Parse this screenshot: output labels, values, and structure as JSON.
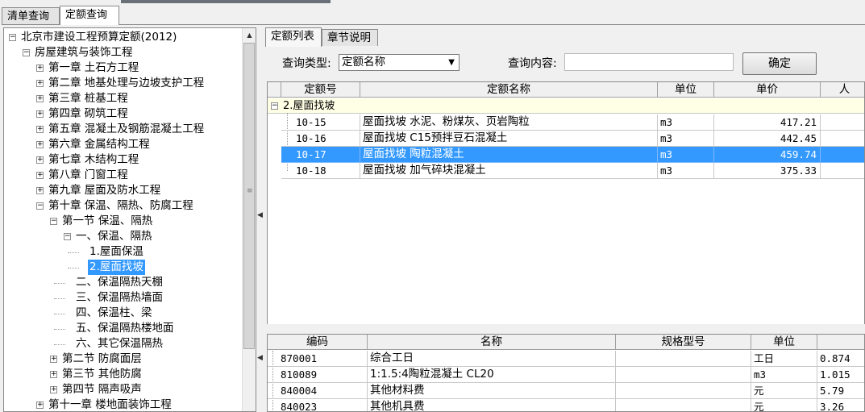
{
  "outer_tabs": [
    "清单查询",
    "定额查询"
  ],
  "tree": [
    {
      "level": 0,
      "expander": "⊟",
      "label": "北京市建设工程预算定额(2012)"
    },
    {
      "level": 1,
      "expander": "⊟",
      "label": "房屋建筑与装饰工程"
    },
    {
      "level": 2,
      "expander": "⊞",
      "label": "第一章 土石方工程"
    },
    {
      "level": 2,
      "expander": "⊞",
      "label": "第二章 地基处理与边坡支护工程"
    },
    {
      "level": 2,
      "expander": "⊞",
      "label": "第三章 桩基工程"
    },
    {
      "level": 2,
      "expander": "⊞",
      "label": "第四章 砌筑工程"
    },
    {
      "level": 2,
      "expander": "⊞",
      "label": "第五章 混凝土及钢筋混凝土工程"
    },
    {
      "level": 2,
      "expander": "⊞",
      "label": "第六章 金属结构工程"
    },
    {
      "level": 2,
      "expander": "⊞",
      "label": "第七章 木结构工程"
    },
    {
      "level": 2,
      "expander": "⊞",
      "label": "第八章 门窗工程"
    },
    {
      "level": 2,
      "expander": "⊞",
      "label": "第九章 屋面及防水工程"
    },
    {
      "level": 2,
      "expander": "⊟",
      "label": "第十章 保温、隔热、防腐工程"
    },
    {
      "level": 3,
      "expander": "⊟",
      "label": "第一节 保温、隔热"
    },
    {
      "level": 4,
      "expander": "⊟",
      "label": "一、保温、隔热"
    },
    {
      "level": 5,
      "expander": "",
      "label": "1.屋面保温"
    },
    {
      "level": 5,
      "expander": "",
      "label": "2.屋面找坡",
      "selected": true
    },
    {
      "level": 4,
      "expander": "",
      "label": "二、保温隔热天棚"
    },
    {
      "level": 4,
      "expander": "",
      "label": "三、保温隔热墙面"
    },
    {
      "level": 4,
      "expander": "",
      "label": "四、保温柱、梁"
    },
    {
      "level": 4,
      "expander": "",
      "label": "五、保温隔热楼地面"
    },
    {
      "level": 4,
      "expander": "",
      "label": "六、其它保温隔热"
    },
    {
      "level": 3,
      "expander": "⊞",
      "label": "第二节 防腐面层"
    },
    {
      "level": 3,
      "expander": "⊞",
      "label": "第三节 其他防腐"
    },
    {
      "level": 3,
      "expander": "⊞",
      "label": "第四节 隔声吸声"
    },
    {
      "level": 2,
      "expander": "⊞",
      "label": "第十一章 楼地面装饰工程"
    }
  ],
  "inner_tabs": [
    "定额列表",
    "章节说明"
  ],
  "query": {
    "type_label": "查询类型:",
    "type_value": "定额名称",
    "content_label": "查询内容:",
    "content_value": "",
    "confirm_label": "确定"
  },
  "quota_table": {
    "headers": [
      "定额号",
      "定额名称",
      "单位",
      "单价",
      "人"
    ],
    "group_label": "2.屋面找坡",
    "rows": [
      {
        "code": "10-15",
        "name": "屋面找坡 水泥、粉煤灰、页岩陶粒",
        "unit": "m3",
        "price": "417.21"
      },
      {
        "code": "10-16",
        "name": "屋面找坡 C15预拌豆石混凝土",
        "unit": "m3",
        "price": "442.45"
      },
      {
        "code": "10-17",
        "name": "屋面找坡 陶粒混凝土",
        "unit": "m3",
        "price": "459.74",
        "selected": true
      },
      {
        "code": "10-18",
        "name": "屋面找坡 加气碎块混凝土",
        "unit": "m3",
        "price": "375.33"
      }
    ]
  },
  "resource_table": {
    "headers": [
      "编码",
      "名称",
      "规格型号",
      "单位",
      ""
    ],
    "rows": [
      {
        "code": "870001",
        "name": "综合工日",
        "spec": "",
        "unit": "工日",
        "qty": "0.874"
      },
      {
        "code": "810089",
        "name": "1:1.5:4陶粒混凝土 CL20",
        "spec": "",
        "unit": "m3",
        "qty": "1.015"
      },
      {
        "code": "840004",
        "name": "其他材料费",
        "spec": "",
        "unit": "元",
        "qty": "5.79"
      },
      {
        "code": "840023",
        "name": "其他机具费",
        "spec": "",
        "unit": "元",
        "qty": "3.26"
      }
    ]
  },
  "colors": {
    "selection": "#3399ff",
    "group_row": "#ffffe6"
  }
}
